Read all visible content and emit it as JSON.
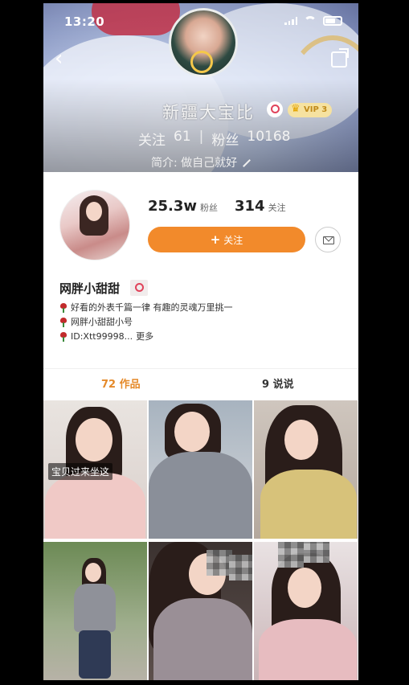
{
  "status": {
    "time": "13:20"
  },
  "banner": {
    "name": "新疆大宝比",
    "vip": "VIP 3",
    "following_label": "关注",
    "following_count": "61",
    "separator": "|",
    "fans_label": "粉丝",
    "fans_count": "10168",
    "bio": "简介: 做自己就好"
  },
  "profile": {
    "fans_value": "25.3w",
    "fans_label": "粉丝",
    "following_value": "314",
    "following_label": "关注",
    "follow_button": "关注",
    "nickname": "网胖小甜甜",
    "bio_lines": [
      "好看的外表千篇一律 有趣的灵魂万里挑一",
      "网胖小甜甜小号",
      "ID:Xtt99998..."
    ],
    "more_label": "更多"
  },
  "tabs": {
    "works": "72 作品",
    "posts": "9 说说"
  },
  "grid": {
    "caption_0": "宝贝过来坐这"
  },
  "colors": {
    "accent": "#f28a2b",
    "tab_active": "#e58a2a"
  }
}
